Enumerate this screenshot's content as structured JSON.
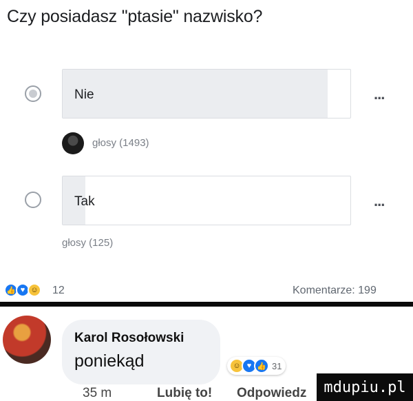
{
  "poll": {
    "question": "Czy posiadasz \"ptasie\" nazwisko?",
    "options": [
      {
        "label": "Nie",
        "votes_text": "głosy (1493)",
        "selected": true,
        "fill_fraction": 0.92
      },
      {
        "label": "Tak",
        "votes_text": "głosy (125)",
        "selected": false,
        "fill_fraction": 0.08
      }
    ],
    "more_label": "..."
  },
  "reactions": {
    "icons": [
      "like-icon",
      "love-icon",
      "haha-icon"
    ],
    "count": "12",
    "comments_label": "Komentarze: 199"
  },
  "comment": {
    "author": "Karol Rosołowski",
    "text": "poniekąd",
    "reaction_count": "31",
    "time": "35 m",
    "like_label": "Lubię to!",
    "reply_label": "Odpowiedz"
  },
  "watermark": "mdupiu.pl",
  "colors": {
    "accent": "#1877f2",
    "bar_fill": "#ebedf0",
    "divider": "#0a0a0a"
  }
}
